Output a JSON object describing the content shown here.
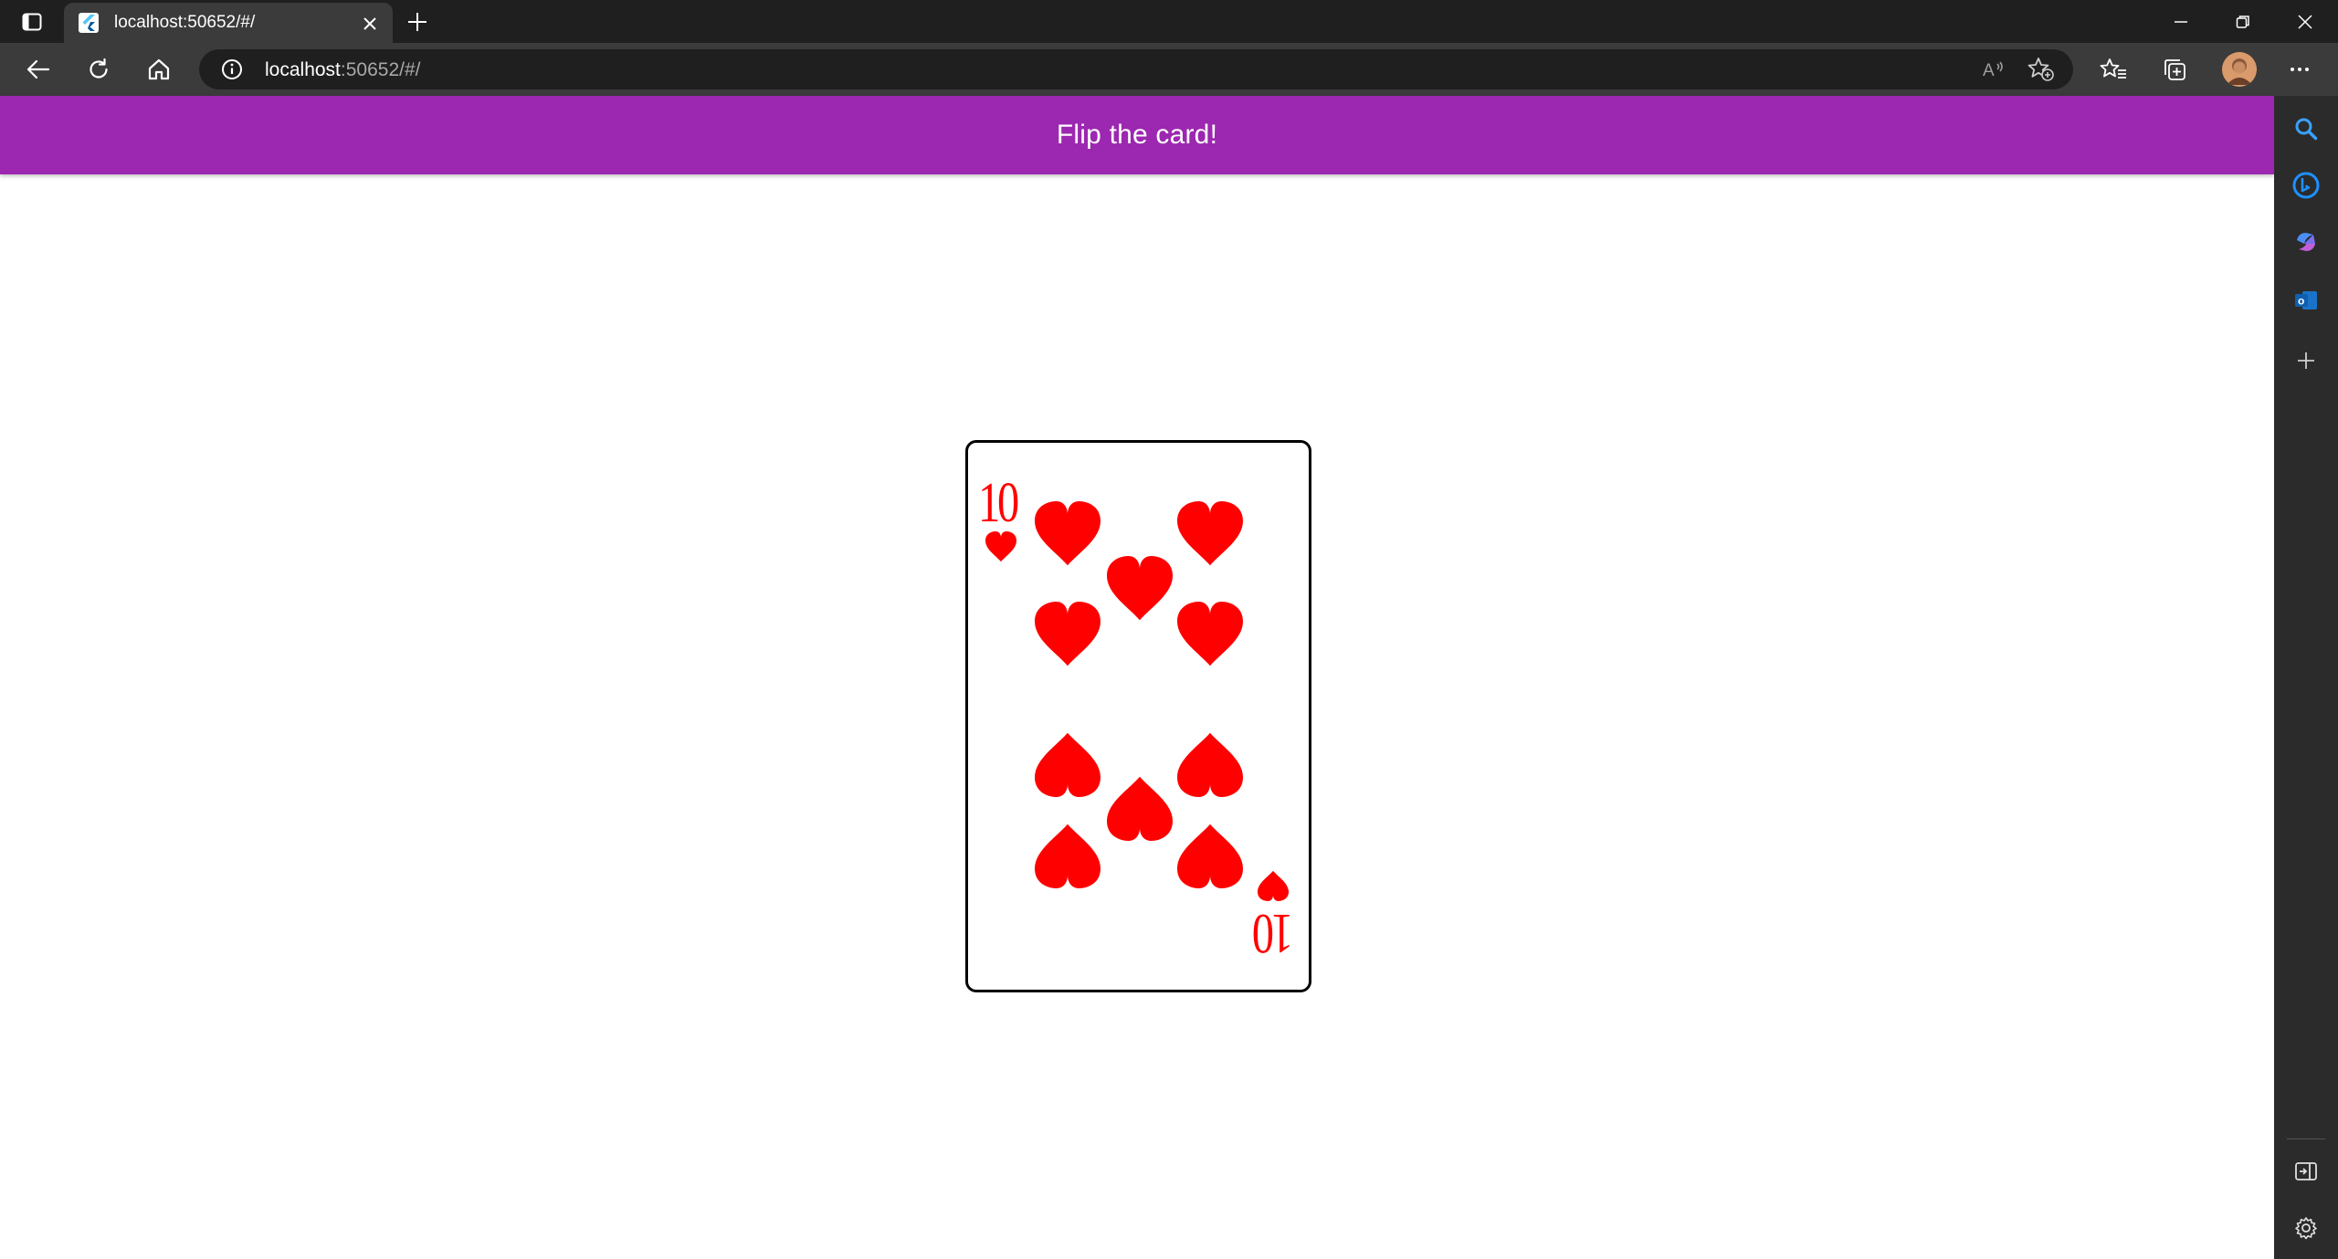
{
  "browser": {
    "tab": {
      "title": "localhost:50652/#/"
    },
    "address": {
      "host": "localhost",
      "rest": ":50652/#/"
    },
    "icons": {
      "tab_actions": "tab-actions-icon",
      "favicon": "flutter-logo-icon",
      "close_tab": "close-icon",
      "new_tab": "plus-icon",
      "minimize": "minimize-icon",
      "restore": "restore-icon",
      "close_window": "close-icon",
      "back": "back-arrow-icon",
      "refresh": "refresh-icon",
      "home": "home-icon",
      "site_info": "info-icon",
      "read_aloud": "read-aloud-icon",
      "add_favorite": "add-favorite-icon",
      "favorites": "favorites-icon",
      "collections": "collections-icon",
      "profile": "profile-avatar",
      "more": "more-icon"
    },
    "sidebar": [
      "search-icon",
      "bing-icon",
      "copilot-icon",
      "outlook-icon",
      "add-icon",
      "hide-sidebar-icon",
      "settings-icon"
    ]
  },
  "app": {
    "title": "Flip the card!",
    "bar_color": "#9c27b0",
    "card": {
      "rank": "10",
      "suit": "hearts",
      "suit_color": "#ff0000",
      "pip_count": 10
    }
  }
}
